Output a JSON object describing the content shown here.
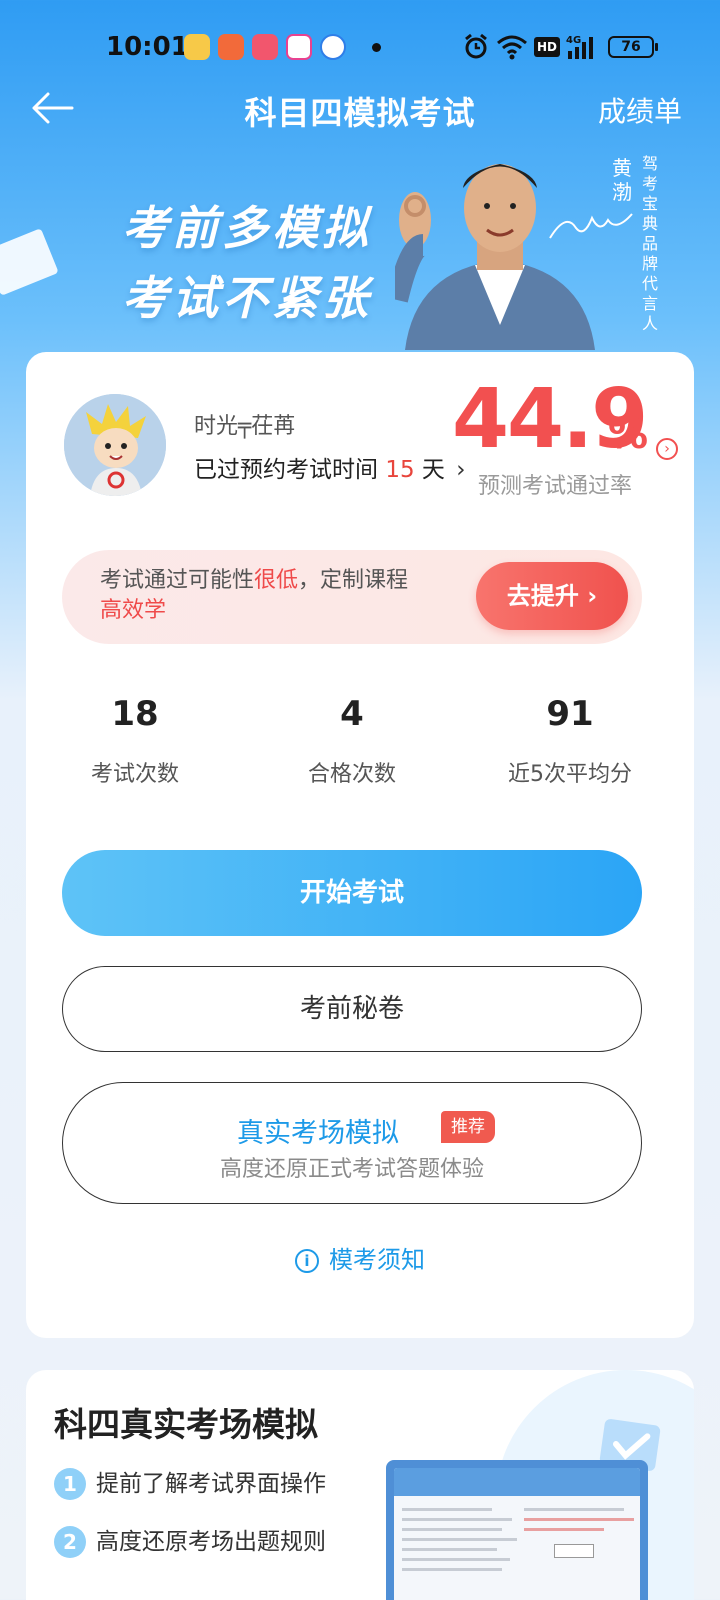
{
  "status_bar": {
    "time": "10:01",
    "battery": "76",
    "network": "4G",
    "hd": "HD"
  },
  "header": {
    "title": "科目四模拟考试",
    "report_link": "成绩单"
  },
  "banner": {
    "slogan_line1": "考前多模拟",
    "slogan_line2": "考试不紧张",
    "endorser_name": "黄渤",
    "endorser_title": "驾考宝典品牌代言人"
  },
  "profile": {
    "username": "时光╤茌苒",
    "days_prefix": "已过预约考试时间",
    "days_value": "15",
    "days_suffix": "天",
    "pass_rate_value": "44.9",
    "pass_rate_unit": "%",
    "pass_rate_label": "预测考试通过率"
  },
  "promo": {
    "text_prefix": "考试通过可能性",
    "text_highlight": "很低",
    "text_middle": "，定制课程",
    "text_highlight2": "高效学",
    "button_label": "去提升 ›"
  },
  "stats": [
    {
      "value": "18",
      "label": "考试次数"
    },
    {
      "value": "4",
      "label": "合格次数"
    },
    {
      "value": "91",
      "label": "近5次平均分"
    }
  ],
  "actions": {
    "start_label": "开始考试",
    "secret_label": "考前秘卷",
    "real_title": "真实考场模拟",
    "real_badge": "推荐",
    "real_subtitle": "高度还原正式考试答题体验",
    "notice_label": "模考须知"
  },
  "bottom": {
    "title": "科四真实考场模拟",
    "features": [
      {
        "num": "1",
        "label": "提前了解考试界面操作"
      },
      {
        "num": "2",
        "label": "高度还原考场出题规则"
      }
    ]
  },
  "colors": {
    "accent_blue": "#2ba5f6",
    "accent_red": "#f25050",
    "text_link": "#1d9ae8"
  }
}
